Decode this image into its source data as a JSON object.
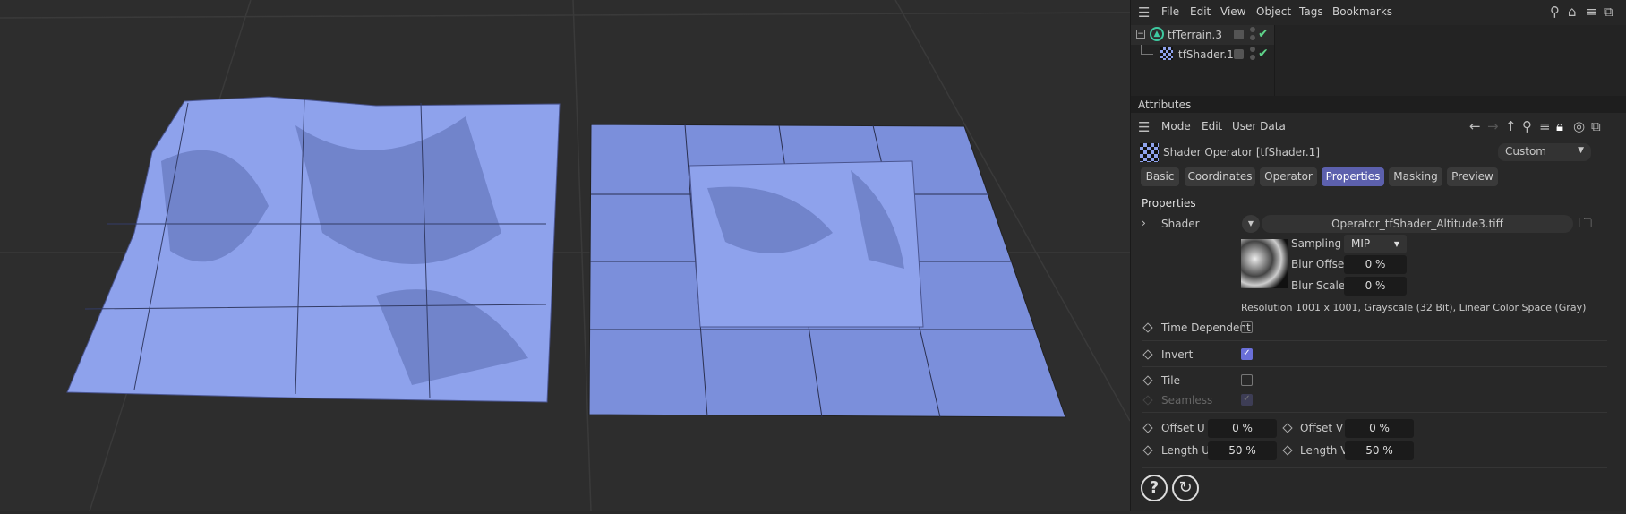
{
  "menubar": {
    "items": [
      "File",
      "Edit",
      "View",
      "Object",
      "Tags",
      "Bookmarks"
    ]
  },
  "tree": {
    "items": [
      {
        "name": "tfTerrain.3",
        "icon": "terrain-icon",
        "enabled": true
      },
      {
        "name": "tfShader.1",
        "icon": "shader-icon",
        "enabled": true
      }
    ]
  },
  "attributes": {
    "title": "Attributes",
    "menu": [
      "Mode",
      "Edit",
      "User Data"
    ],
    "object_title": "Shader Operator [tfShader.1]",
    "preset": "Custom",
    "tabs": [
      "Basic",
      "Coordinates",
      "Operator",
      "Properties",
      "Masking",
      "Preview"
    ],
    "active_tab": "Properties",
    "section": "Properties",
    "shader": {
      "label": "Shader",
      "file": "Operator_tfShader_Altitude3.tiff",
      "sampling_label": "Sampling",
      "sampling": "MIP",
      "blur_offset_label": "Blur Offset",
      "blur_offset": "0 %",
      "blur_scale_label": "Blur Scale",
      "blur_scale": "0 %",
      "resolution": "Resolution 1001 x 1001, Grayscale (32 Bit), Linear Color Space (Gray)"
    },
    "time_dependent": {
      "label": "Time Dependent",
      "checked": false
    },
    "invert": {
      "label": "Invert",
      "checked": true
    },
    "tile": {
      "label": "Tile",
      "checked": false
    },
    "seamless": {
      "label": "Seamless",
      "checked": true,
      "disabled": true
    },
    "offset_u": {
      "label": "Offset U",
      "value": "0 %"
    },
    "offset_v": {
      "label": "Offset V",
      "value": "0 %"
    },
    "length_u": {
      "label": "Length U",
      "value": "50 %"
    },
    "length_v": {
      "label": "Length V",
      "value": "50 %"
    }
  },
  "colors": {
    "terrain": "#8ea2ec",
    "accent": "#5c60ad",
    "check": "#5fd38a"
  }
}
